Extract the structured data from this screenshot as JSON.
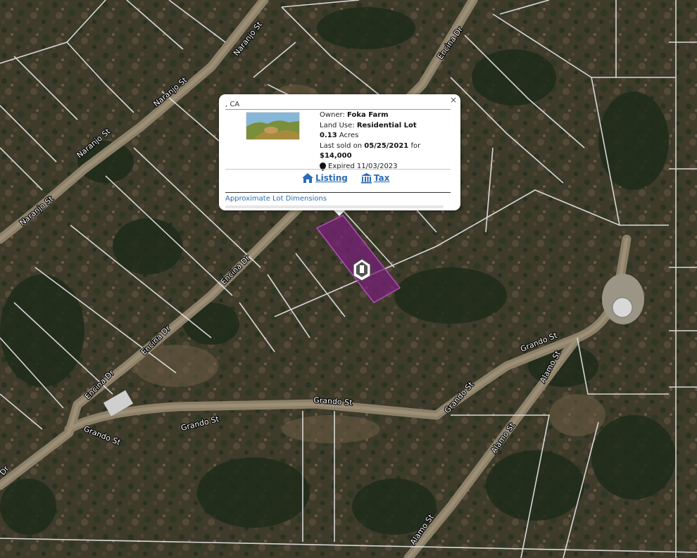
{
  "map": {
    "streets": [
      "Naranjo St",
      "Naranjo St",
      "Naranjo St",
      "Naranjo St",
      "Encina Dr",
      "Encina Dr",
      "Encina Dr",
      "Encina Dr",
      "Grando St",
      "Grando St",
      "Grando St",
      "Grando St",
      "Grando St",
      "Alamo St",
      "Alamo St",
      "Alamo St",
      "Dr"
    ],
    "parcel_color": "#7a1f7c",
    "marker_icon": "parcel-marker-icon"
  },
  "popup": {
    "address": ", CA",
    "owner_label": "Owner:",
    "owner": "Foka Farm",
    "land_use_label": "Land Use:",
    "land_use": "Residential Lot",
    "acres_value": "0.13",
    "acres_unit": "Acres",
    "sold_prefix": "Last sold on",
    "sold_date": "05/25/2021",
    "sold_for": "for",
    "price": "$14,000",
    "expired": "Expired 11/03/2023",
    "listing_label": "Listing",
    "tax_label": "Tax",
    "dimensions_label": "Approximate Lot Dimensions",
    "close_symbol": "×",
    "link_color": "#2e6db4"
  }
}
